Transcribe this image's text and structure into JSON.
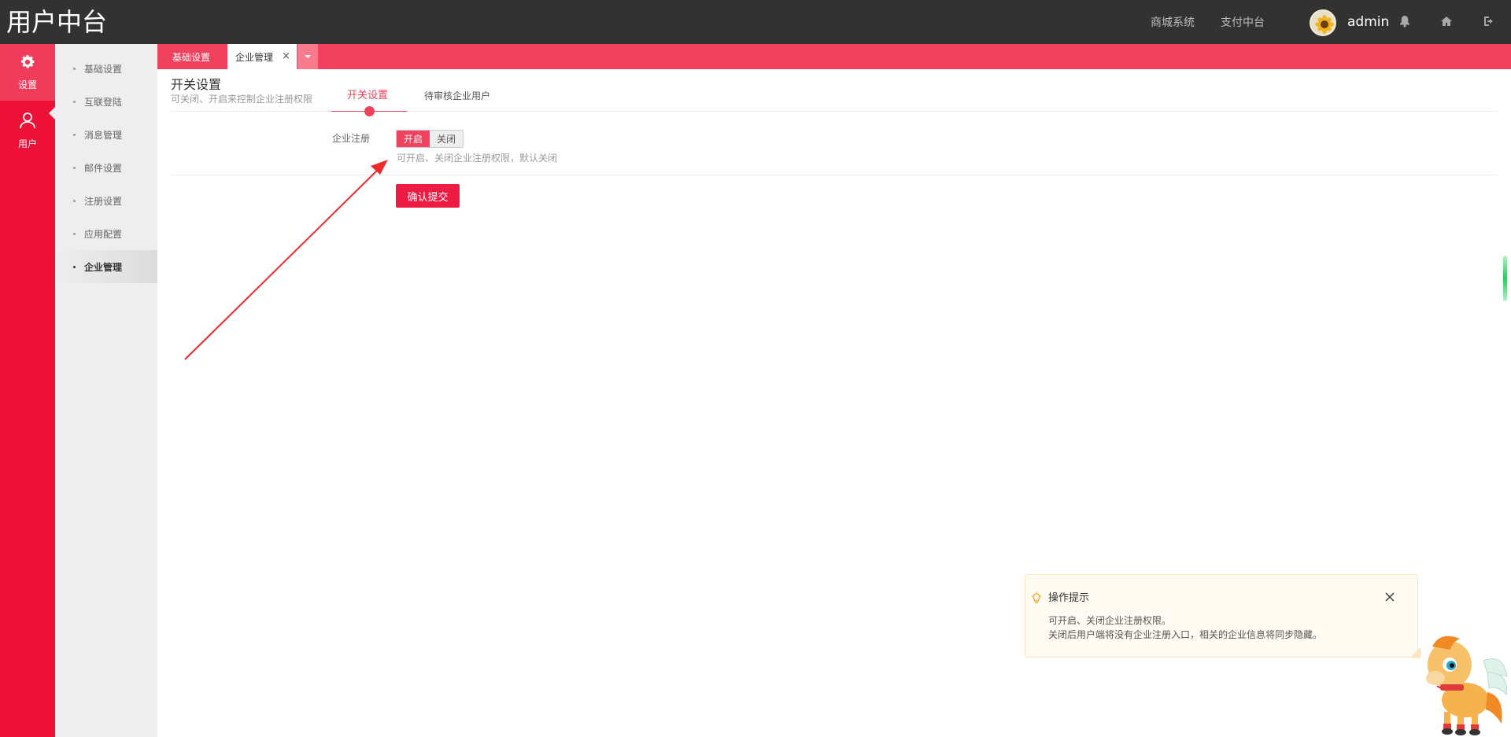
{
  "app": {
    "title": "用户中台"
  },
  "top": {
    "links": [
      "商城系统",
      "支付中台"
    ],
    "user": "admin"
  },
  "rail": {
    "items": [
      {
        "label": "设置",
        "icon": "gear-icon",
        "active": true
      },
      {
        "label": "用户",
        "icon": "user-icon",
        "active": false
      }
    ]
  },
  "submenu": {
    "items": [
      {
        "label": "基础设置"
      },
      {
        "label": "互联登陆"
      },
      {
        "label": "消息管理"
      },
      {
        "label": "邮件设置"
      },
      {
        "label": "注册设置"
      },
      {
        "label": "应用配置"
      },
      {
        "label": "企业管理"
      }
    ],
    "active_index": 6
  },
  "tabs": {
    "items": [
      {
        "label": "基础设置"
      },
      {
        "label": "企业管理"
      }
    ],
    "close_glyph": "×"
  },
  "section": {
    "title": "开关设置",
    "subtitle": "可关闭、开启来控制企业注册权限",
    "tabs": [
      "开关设置",
      "待审核企业用户"
    ]
  },
  "form": {
    "label": "企业注册",
    "toggle_on": "开启",
    "toggle_off": "关闭",
    "selected": "开启",
    "help": "可开启、关闭企业注册权限，默认关闭",
    "submit": "确认提交"
  },
  "tip": {
    "title": "操作提示",
    "lines": [
      "可开启、关闭企业注册权限。",
      "关闭后用户端将没有企业注册入口，相关的企业信息将同步隐藏。"
    ]
  },
  "colors": {
    "accent": "#f0425e",
    "rail": "#ee1137",
    "topbar": "#323232",
    "annotation_arrow": "#ee2a2a"
  }
}
